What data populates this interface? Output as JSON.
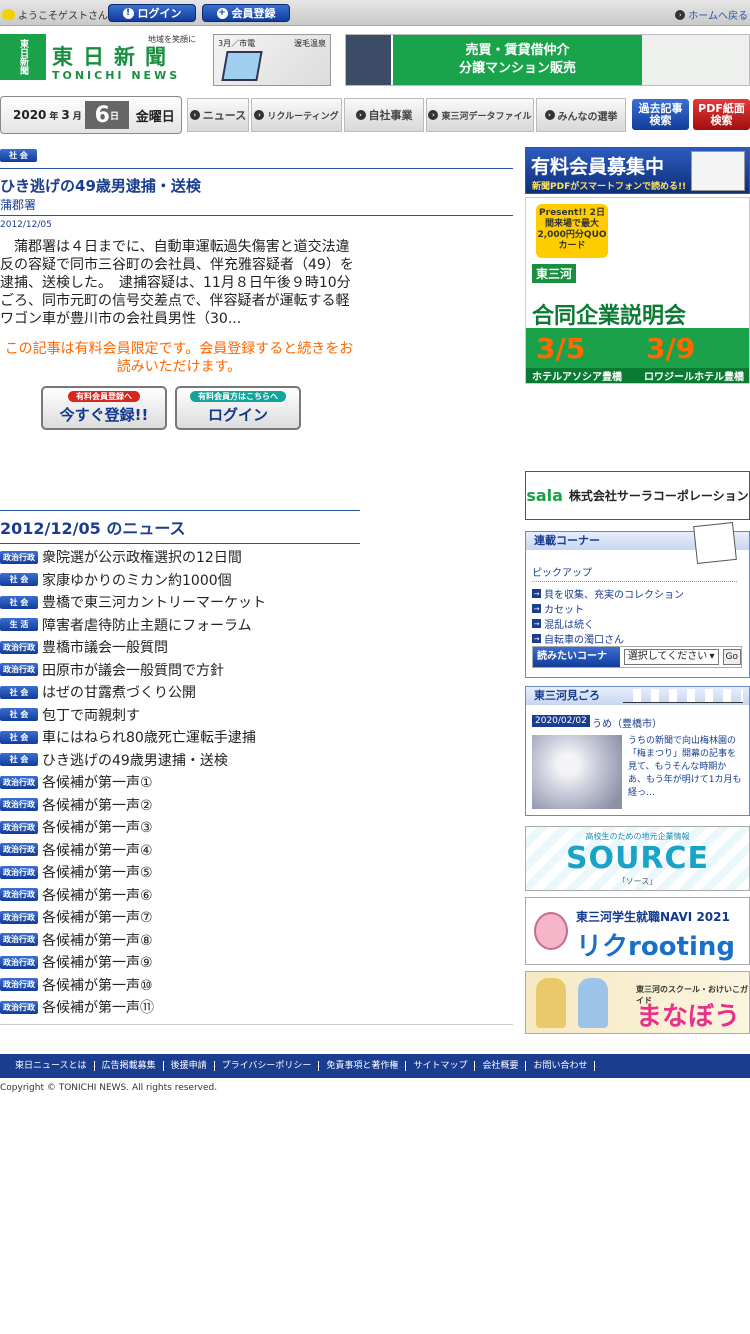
{
  "topbar": {
    "guest": "ようこそゲストさん",
    "login": "ログイン",
    "register": "会員登録",
    "home": "ホームへ戻る"
  },
  "header": {
    "logo_vertical": "東日新聞",
    "logo_tagline": "地域を笑顔に",
    "logo_jp": "東日新聞",
    "logo_en": "TONICHI NEWS",
    "ad_train_left": "3月／市電",
    "ad_train_right": "渥毛温泉",
    "ad_banner_line1": "売買・賃貸借仲介",
    "ad_banner_line2": "分譲マンション販売"
  },
  "date": {
    "year": "2020",
    "year_unit": "年",
    "month": "3",
    "month_unit": "月",
    "day": "6",
    "day_unit": "日",
    "weekday": "金曜日"
  },
  "nav": {
    "items": [
      "ニュース",
      "リクルーティング",
      "自社事業",
      "東三河データファイル",
      "みんなの選挙"
    ],
    "archive_line1": "過去記事",
    "archive_line2": "検索",
    "pdf_line1": "PDF紙面",
    "pdf_line2": "検索"
  },
  "article": {
    "category": "社 会",
    "title": "ひき逃げの49歳男逮捕・送検",
    "source": "蒲郡署",
    "date": "2012/12/05",
    "body": "　蒲郡署は４日までに、自動車運転過失傷害と道交法違反の容疑で同市三谷町の会社員、伴充雅容疑者（49）を逮捕、送検した。　逮捕容疑は、11月８日午後９時10分ごろ、同市元町の信号交差点で、伴容疑者が運転する軽ワゴン車が豊川市の会社員男性（30...",
    "paywall": "この記事は有料会員限定です。会員登録すると続きをお読みいただけます。",
    "register_tag": "有料会員登録へ",
    "register_label": "今すぐ登録!!",
    "login_tag": "有料会員方はこちらへ",
    "login_label": "ログイン"
  },
  "news": {
    "title": "2012/12/05 のニュース",
    "items": [
      {
        "cat": "政治行政",
        "title": "衆院選が公示政権選択の12日間"
      },
      {
        "cat": "社 会",
        "title": "家康ゆかりのミカン約1000個"
      },
      {
        "cat": "社 会",
        "title": "豊橋で東三河カントリーマーケット"
      },
      {
        "cat": "生 活",
        "title": "障害者虐待防止主題にフォーラム"
      },
      {
        "cat": "政治行政",
        "title": "豊橋市議会一般質問"
      },
      {
        "cat": "政治行政",
        "title": "田原市が議会一般質問で方針"
      },
      {
        "cat": "社 会",
        "title": "はぜの甘露煮づくり公開"
      },
      {
        "cat": "社 会",
        "title": "包丁で両親刺す"
      },
      {
        "cat": "社 会",
        "title": "車にはねられ80歳死亡運転手逮捕"
      },
      {
        "cat": "社 会",
        "title": "ひき逃げの49歳男逮捕・送検"
      },
      {
        "cat": "政治行政",
        "title": "各候補が第一声①"
      },
      {
        "cat": "政治行政",
        "title": "各候補が第一声②"
      },
      {
        "cat": "政治行政",
        "title": "各候補が第一声③"
      },
      {
        "cat": "政治行政",
        "title": "各候補が第一声④"
      },
      {
        "cat": "政治行政",
        "title": "各候補が第一声⑤"
      },
      {
        "cat": "政治行政",
        "title": "各候補が第一声⑥"
      },
      {
        "cat": "政治行政",
        "title": "各候補が第一声⑦"
      },
      {
        "cat": "政治行政",
        "title": "各候補が第一声⑧"
      },
      {
        "cat": "政治行政",
        "title": "各候補が第一声⑨"
      },
      {
        "cat": "政治行政",
        "title": "各候補が第一声⑩"
      },
      {
        "cat": "政治行政",
        "title": "各候補が第一声⑪"
      }
    ]
  },
  "sidebar": {
    "member_ad_title": "有料会員募集中",
    "member_ad_sub": "新聞PDFがスマートフォンで読める!!",
    "fair_present": "Present!! 2日間来場で最大2,000円分QUOカード",
    "fair_region": "東三河",
    "fair_title": "合同企業説明会",
    "fair_date1": "3/5",
    "fair_date2": "3/9",
    "fair_venue1": "ホテルアソシア豊橋",
    "fair_venue2": "ロワジールホテル豊橋",
    "sala_logo": "sala",
    "sala_name": "株式会社サーラコーポレーション",
    "series_title": "連載コーナー",
    "series_pickup": "ピックアップ",
    "series_items": [
      "貝を収集、充実のコレクション",
      "カセット",
      "混乱は続く",
      "自転車の濁口さん"
    ],
    "series_select_label": "読みたいコーナー",
    "series_select_value": "選択してください",
    "series_go": "Go",
    "season_title": "東三河見ごろ",
    "season_date": "2020/02/02",
    "season_item": "うめ（豊橋市）",
    "season_desc": "うちの新聞で向山梅林園の「梅まつり」開幕の記事を見て、もうそんな時期かあ、もう年が明けて1カ月も経っ…",
    "source_sub": "高校生のための地元企業情報",
    "source_title": "SOURCE",
    "source_kana": "「ソース」",
    "rik_sub": "東三河学生就職NAVI 2021",
    "rik_title": "リクrooting",
    "mana_sub": "東三河のスクール・おけいこガイド",
    "mana_title": "まなぼう"
  },
  "footer": {
    "links": [
      "東日ニュースとは",
      "広告掲載募集",
      "後援申請",
      "プライバシーポリシー",
      "免責事項と著作権",
      "サイトマップ",
      "会社概要",
      "お問い合わせ"
    ],
    "copyright": "Copyright © TONICHI NEWS. All rights reserved."
  },
  "colors": {
    "brand_blue": "#1a3d8f",
    "brand_green": "#1aa14a",
    "paywall_orange": "#ff6600"
  }
}
